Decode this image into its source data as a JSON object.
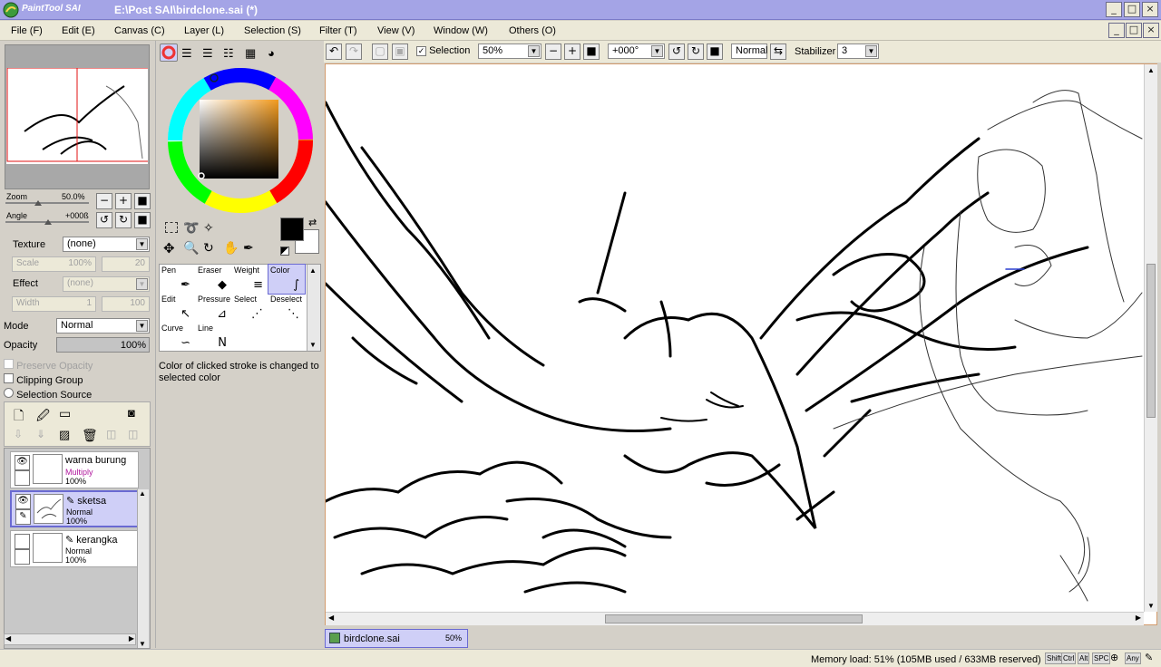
{
  "app": {
    "title": "E:\\Post SAI\\birdclone.sai (*)",
    "logo_text": "PaintTool SAI"
  },
  "window_controls": {
    "minimize": "_",
    "maximize": "□",
    "close": "×"
  },
  "menu": [
    "File (F)",
    "Edit (E)",
    "Canvas (C)",
    "Layer (L)",
    "Selection (S)",
    "Filter (T)",
    "View (V)",
    "Window (W)",
    "Others (O)"
  ],
  "navigator": {
    "zoom_label": "Zoom",
    "zoom_value": "50.0%",
    "angle_label": "Angle",
    "angle_value": "+000ß"
  },
  "texture": {
    "label": "Texture",
    "value": "(none)",
    "scale_label": "Scale",
    "scale_value": "100%",
    "scale_num": "20"
  },
  "effect": {
    "label": "Effect",
    "value": "(none)",
    "width_label": "Width",
    "width_value": "1",
    "width_num": "100"
  },
  "layer_props": {
    "mode_label": "Mode",
    "mode_value": "Normal",
    "opacity_label": "Opacity",
    "opacity_value": "100%",
    "opacity_fraction": 1.0,
    "preserve_opacity": "Preserve Opacity",
    "clipping_group": "Clipping Group",
    "selection_source": "Selection Source"
  },
  "layers": [
    {
      "name": "warna burung",
      "mode": "Multiply",
      "opacity": "100%",
      "selected": false,
      "mode_color": "#b0179d"
    },
    {
      "name": "sketsa",
      "mode": "Normal",
      "opacity": "100%",
      "selected": true,
      "mode_color": "#000000"
    },
    {
      "name": "kerangka",
      "mode": "Normal",
      "opacity": "100%",
      "selected": false,
      "mode_color": "#000000"
    }
  ],
  "colors": {
    "primary": "#000000",
    "secondary": "#ffffff",
    "accent": "#6a6ad2",
    "titlebar": "#a4a4e6"
  },
  "tools": [
    {
      "label": "Pen",
      "icon": "pen-icon"
    },
    {
      "label": "Eraser",
      "icon": "eraser-icon"
    },
    {
      "label": "Weight",
      "icon": "weight-icon"
    },
    {
      "label": "Color",
      "icon": "color-icon"
    },
    {
      "label": "Edit",
      "icon": "edit-icon"
    },
    {
      "label": "Pressure",
      "icon": "pressure-icon"
    },
    {
      "label": "Select",
      "icon": "select-icon"
    },
    {
      "label": "Deselect",
      "icon": "deselect-icon"
    },
    {
      "label": "Curve",
      "icon": "curve-icon"
    },
    {
      "label": "Line",
      "icon": "line-icon"
    }
  ],
  "tool_hint": "Color of clicked stroke is changed to selected color",
  "toolbar": {
    "selection_label": "Selection",
    "zoom": "50%",
    "angle": "+000°",
    "blend": "Normal",
    "stabilizer_label": "Stabilizer",
    "stabilizer": "3"
  },
  "doc_tab": {
    "name": "birdclone.sai",
    "zoom": "50%"
  },
  "status": {
    "memory": "Memory load: 51% (105MB used / 633MB reserved)",
    "keys": [
      "Shift",
      "Ctrl",
      "Alt",
      "SPC",
      "Any"
    ]
  }
}
